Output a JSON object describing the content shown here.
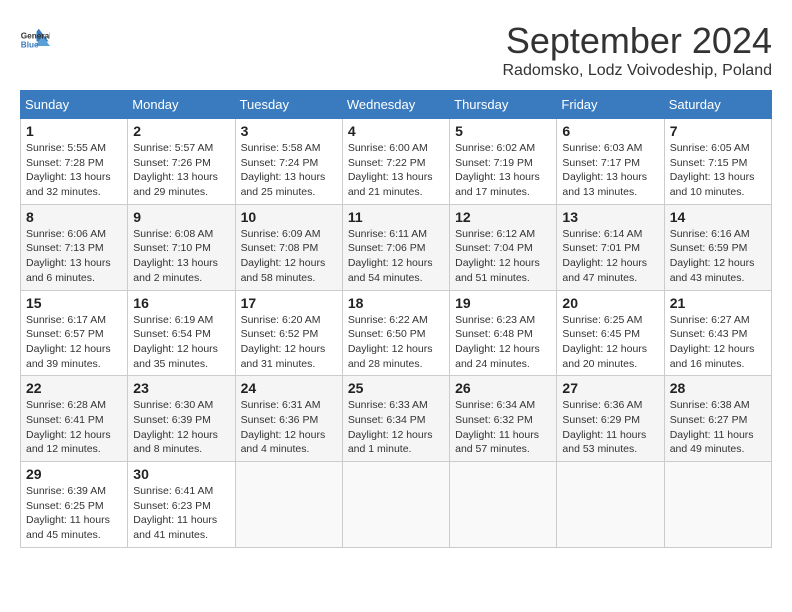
{
  "logo": {
    "line1": "General",
    "line2": "Blue"
  },
  "title": "September 2024",
  "subtitle": "Radomsko, Lodz Voivodeship, Poland",
  "weekdays": [
    "Sunday",
    "Monday",
    "Tuesday",
    "Wednesday",
    "Thursday",
    "Friday",
    "Saturday"
  ],
  "weeks": [
    [
      {
        "day": "1",
        "info": "Sunrise: 5:55 AM\nSunset: 7:28 PM\nDaylight: 13 hours\nand 32 minutes."
      },
      {
        "day": "2",
        "info": "Sunrise: 5:57 AM\nSunset: 7:26 PM\nDaylight: 13 hours\nand 29 minutes."
      },
      {
        "day": "3",
        "info": "Sunrise: 5:58 AM\nSunset: 7:24 PM\nDaylight: 13 hours\nand 25 minutes."
      },
      {
        "day": "4",
        "info": "Sunrise: 6:00 AM\nSunset: 7:22 PM\nDaylight: 13 hours\nand 21 minutes."
      },
      {
        "day": "5",
        "info": "Sunrise: 6:02 AM\nSunset: 7:19 PM\nDaylight: 13 hours\nand 17 minutes."
      },
      {
        "day": "6",
        "info": "Sunrise: 6:03 AM\nSunset: 7:17 PM\nDaylight: 13 hours\nand 13 minutes."
      },
      {
        "day": "7",
        "info": "Sunrise: 6:05 AM\nSunset: 7:15 PM\nDaylight: 13 hours\nand 10 minutes."
      }
    ],
    [
      {
        "day": "8",
        "info": "Sunrise: 6:06 AM\nSunset: 7:13 PM\nDaylight: 13 hours\nand 6 minutes."
      },
      {
        "day": "9",
        "info": "Sunrise: 6:08 AM\nSunset: 7:10 PM\nDaylight: 13 hours\nand 2 minutes."
      },
      {
        "day": "10",
        "info": "Sunrise: 6:09 AM\nSunset: 7:08 PM\nDaylight: 12 hours\nand 58 minutes."
      },
      {
        "day": "11",
        "info": "Sunrise: 6:11 AM\nSunset: 7:06 PM\nDaylight: 12 hours\nand 54 minutes."
      },
      {
        "day": "12",
        "info": "Sunrise: 6:12 AM\nSunset: 7:04 PM\nDaylight: 12 hours\nand 51 minutes."
      },
      {
        "day": "13",
        "info": "Sunrise: 6:14 AM\nSunset: 7:01 PM\nDaylight: 12 hours\nand 47 minutes."
      },
      {
        "day": "14",
        "info": "Sunrise: 6:16 AM\nSunset: 6:59 PM\nDaylight: 12 hours\nand 43 minutes."
      }
    ],
    [
      {
        "day": "15",
        "info": "Sunrise: 6:17 AM\nSunset: 6:57 PM\nDaylight: 12 hours\nand 39 minutes."
      },
      {
        "day": "16",
        "info": "Sunrise: 6:19 AM\nSunset: 6:54 PM\nDaylight: 12 hours\nand 35 minutes."
      },
      {
        "day": "17",
        "info": "Sunrise: 6:20 AM\nSunset: 6:52 PM\nDaylight: 12 hours\nand 31 minutes."
      },
      {
        "day": "18",
        "info": "Sunrise: 6:22 AM\nSunset: 6:50 PM\nDaylight: 12 hours\nand 28 minutes."
      },
      {
        "day": "19",
        "info": "Sunrise: 6:23 AM\nSunset: 6:48 PM\nDaylight: 12 hours\nand 24 minutes."
      },
      {
        "day": "20",
        "info": "Sunrise: 6:25 AM\nSunset: 6:45 PM\nDaylight: 12 hours\nand 20 minutes."
      },
      {
        "day": "21",
        "info": "Sunrise: 6:27 AM\nSunset: 6:43 PM\nDaylight: 12 hours\nand 16 minutes."
      }
    ],
    [
      {
        "day": "22",
        "info": "Sunrise: 6:28 AM\nSunset: 6:41 PM\nDaylight: 12 hours\nand 12 minutes."
      },
      {
        "day": "23",
        "info": "Sunrise: 6:30 AM\nSunset: 6:39 PM\nDaylight: 12 hours\nand 8 minutes."
      },
      {
        "day": "24",
        "info": "Sunrise: 6:31 AM\nSunset: 6:36 PM\nDaylight: 12 hours\nand 4 minutes."
      },
      {
        "day": "25",
        "info": "Sunrise: 6:33 AM\nSunset: 6:34 PM\nDaylight: 12 hours\nand 1 minute."
      },
      {
        "day": "26",
        "info": "Sunrise: 6:34 AM\nSunset: 6:32 PM\nDaylight: 11 hours\nand 57 minutes."
      },
      {
        "day": "27",
        "info": "Sunrise: 6:36 AM\nSunset: 6:29 PM\nDaylight: 11 hours\nand 53 minutes."
      },
      {
        "day": "28",
        "info": "Sunrise: 6:38 AM\nSunset: 6:27 PM\nDaylight: 11 hours\nand 49 minutes."
      }
    ],
    [
      {
        "day": "29",
        "info": "Sunrise: 6:39 AM\nSunset: 6:25 PM\nDaylight: 11 hours\nand 45 minutes."
      },
      {
        "day": "30",
        "info": "Sunrise: 6:41 AM\nSunset: 6:23 PM\nDaylight: 11 hours\nand 41 minutes."
      },
      {
        "day": "",
        "info": ""
      },
      {
        "day": "",
        "info": ""
      },
      {
        "day": "",
        "info": ""
      },
      {
        "day": "",
        "info": ""
      },
      {
        "day": "",
        "info": ""
      }
    ]
  ]
}
